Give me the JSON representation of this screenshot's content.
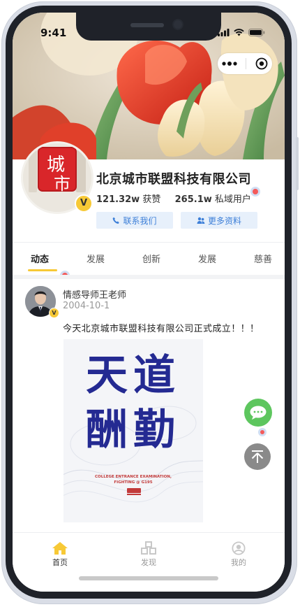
{
  "status_bar": {
    "time": "9:41"
  },
  "profile": {
    "company_name": "北京城市联盟科技有限公司",
    "avatar_text_top": "城",
    "avatar_text_bottom": "市",
    "verified_badge": "V",
    "likes_count": "121.32w",
    "likes_label": "获赞",
    "users_count": "265.1w",
    "users_label": "私域用户",
    "contact_button": "联系我们",
    "more_info_button": "更多资料"
  },
  "tabs": [
    {
      "label": "动态",
      "active": true
    },
    {
      "label": "发展"
    },
    {
      "label": "创新"
    },
    {
      "label": "发展"
    },
    {
      "label": "慈善"
    }
  ],
  "post": {
    "author_name": "情感导师王老师",
    "date": "2004-10-1",
    "author_badge": "V",
    "text": "今天北京城市联盟科技有限公司正式成立！！！",
    "poster": {
      "line1": "天道",
      "line2": "酬勤",
      "sub1": "COLLEGE ENTRANCE EXAMINATION,",
      "sub2": "FIGHTING @ G195"
    }
  },
  "bottom_nav": [
    {
      "label": "首页",
      "icon": "home-icon",
      "active": true
    },
    {
      "label": "发现",
      "icon": "discover-icon"
    },
    {
      "label": "我的",
      "icon": "profile-icon"
    }
  ],
  "colors": {
    "accent_yellow": "#f7c936",
    "button_blue": "#3d7fd8",
    "button_bg": "#e7f0fb",
    "chat_green": "#5dc65e",
    "poster_blue": "#242a92"
  }
}
